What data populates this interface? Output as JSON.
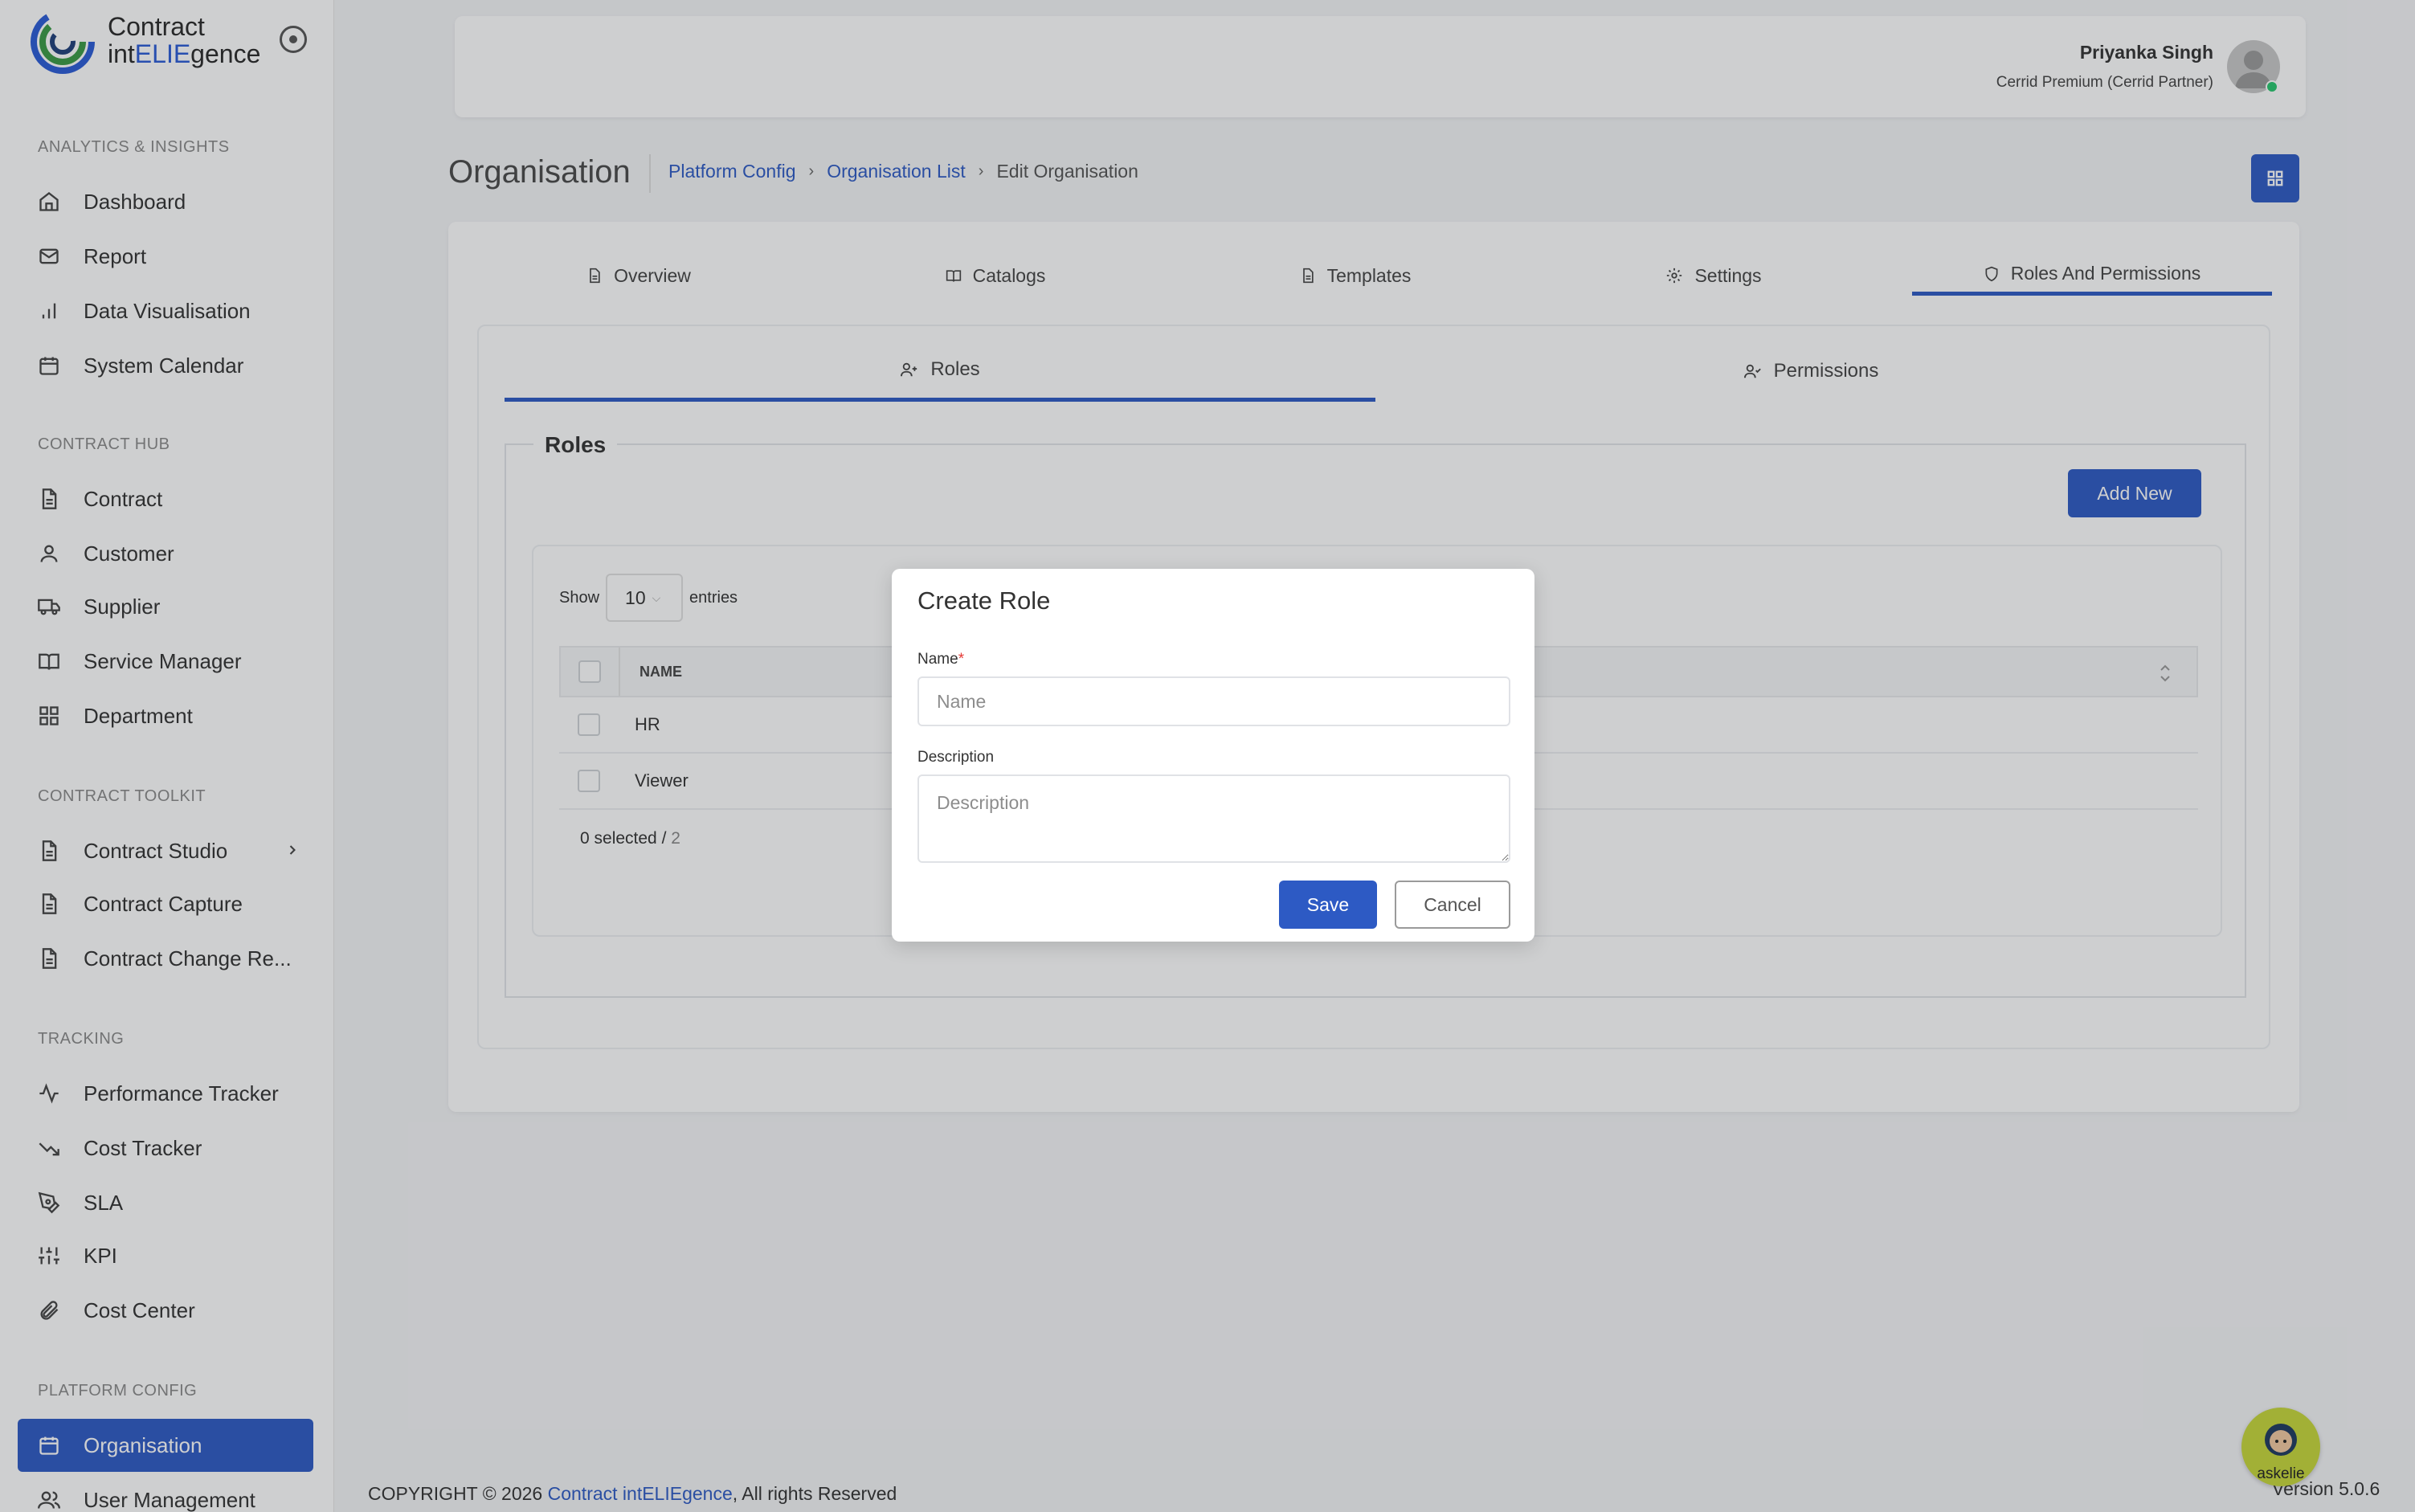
{
  "brand": {
    "logo_line1": "Contract",
    "logo_line2_prefix": "int",
    "logo_line2_accent": "ELIE",
    "logo_line2_suffix": "gence"
  },
  "sidebar": {
    "sections": [
      {
        "label": "ANALYTICS & INSIGHTS",
        "items": [
          {
            "label": "Dashboard",
            "icon": "home-icon"
          },
          {
            "label": "Report",
            "icon": "mail-icon"
          },
          {
            "label": "Data Visualisation",
            "icon": "bar-chart-icon"
          },
          {
            "label": "System Calendar",
            "icon": "calendar-icon"
          }
        ]
      },
      {
        "label": "CONTRACT HUB",
        "items": [
          {
            "label": "Contract",
            "icon": "file-icon"
          },
          {
            "label": "Customer",
            "icon": "user-icon"
          },
          {
            "label": "Supplier",
            "icon": "truck-icon"
          },
          {
            "label": "Service Manager",
            "icon": "book-icon"
          },
          {
            "label": "Department",
            "icon": "grid-icon"
          }
        ]
      },
      {
        "label": "CONTRACT TOOLKIT",
        "items": [
          {
            "label": "Contract Studio",
            "icon": "file-icon"
          },
          {
            "label": "Contract Capture",
            "icon": "file-icon"
          },
          {
            "label": "Contract Change Re...",
            "icon": "file-icon"
          }
        ]
      },
      {
        "label": "TRACKING",
        "items": [
          {
            "label": "Performance Tracker",
            "icon": "activity-icon"
          },
          {
            "label": "Cost Tracker",
            "icon": "trending-down-icon"
          },
          {
            "label": "SLA",
            "icon": "pen-tool-icon"
          },
          {
            "label": "KPI",
            "icon": "sliders-icon"
          },
          {
            "label": "Cost Center",
            "icon": "paperclip-icon"
          }
        ]
      },
      {
        "label": "PLATFORM CONFIG",
        "items": [
          {
            "label": "Organisation",
            "icon": "calendar-icon"
          },
          {
            "label": "User Management",
            "icon": "users-icon"
          }
        ]
      }
    ]
  },
  "header": {
    "user_name": "Priyanka Singh",
    "user_role": "Cerrid Premium (Cerrid Partner)"
  },
  "page": {
    "title": "Organisation",
    "breadcrumb": [
      "Platform Config",
      "Organisation List",
      "Edit Organisation"
    ]
  },
  "tabs": [
    "Overview",
    "Catalogs",
    "Templates",
    "Settings",
    "Roles And Permissions"
  ],
  "active_tab": "Roles And Permissions",
  "subtabs": [
    "Roles",
    "Permissions"
  ],
  "roles_panel": {
    "legend": "Roles",
    "add_button": "Add New",
    "show_label": "Show",
    "entries_value": "10",
    "entries_label": "entries",
    "column_name": "NAME",
    "rows": [
      "HR",
      "Viewer"
    ],
    "selected_count": "0 selected /",
    "total_count": "2"
  },
  "modal": {
    "title": "Create Role",
    "name_label": "Name",
    "name_required": "*",
    "name_placeholder": "Name",
    "description_label": "Description",
    "description_placeholder": "Description",
    "save_label": "Save",
    "cancel_label": "Cancel"
  },
  "footer": {
    "copyright_prefix": "COPYRIGHT © 2026",
    "company_link": "Contract intELIEgence",
    "copyright_suffix": ", All rights Reserved",
    "version": "Version 5.0.6",
    "assistant_label": "askelie"
  },
  "colors": {
    "primary": "#2d5ac4",
    "status_online": "#28c76f",
    "assistant_badge": "#c7d83a",
    "required": "#e53935"
  }
}
